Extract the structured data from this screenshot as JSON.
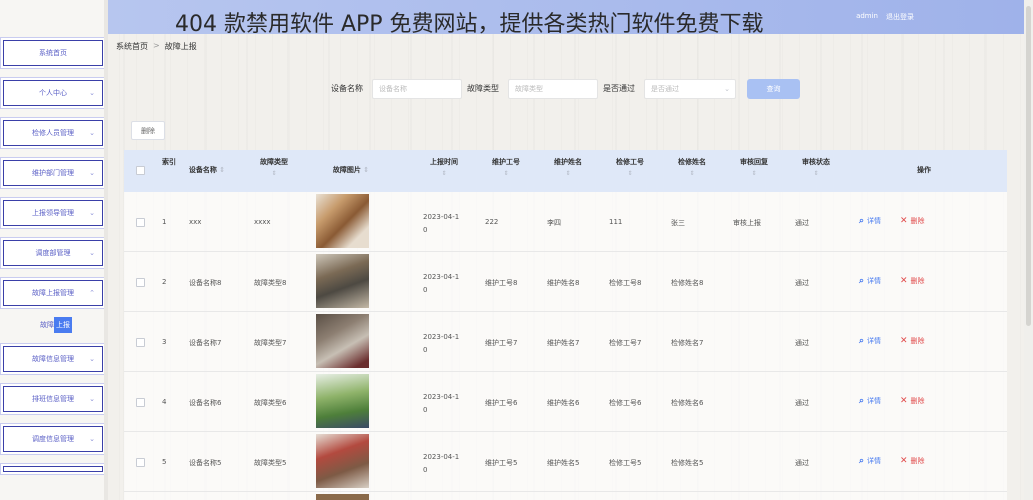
{
  "overlay_title": "404 款禁用软件 APP 免费网站，提供各类热门软件免费下载",
  "topbar": {
    "user": "admin",
    "logout": "退出登录"
  },
  "sidebar": {
    "items": [
      {
        "label": "系统首页",
        "chevron": ""
      },
      {
        "label": "个人中心",
        "chevron": "⌄"
      },
      {
        "label": "检修人员管理",
        "chevron": "⌄"
      },
      {
        "label": "维护部门管理",
        "chevron": "⌄"
      },
      {
        "label": "上报领导管理",
        "chevron": "⌄"
      },
      {
        "label": "调度部管理",
        "chevron": "⌄"
      },
      {
        "label": "故障上报管理",
        "chevron": "⌃"
      },
      {
        "label": "故障信息管理",
        "chevron": "⌄"
      },
      {
        "label": "排班信息管理",
        "chevron": "⌄"
      },
      {
        "label": "调度信息管理",
        "chevron": "⌄"
      }
    ],
    "submenu": {
      "prefix": "故障",
      "highlight": "上报"
    }
  },
  "breadcrumb": {
    "home": "系统首页",
    "sep": ">",
    "current": "故障上报"
  },
  "search": {
    "device_label": "设备名称",
    "device_placeholder": "设备名称",
    "fault_label": "故障类型",
    "fault_placeholder": "故障类型",
    "pass_label": "是否通过",
    "pass_placeholder": "是否通过",
    "query": "查询"
  },
  "toolbar": {
    "delete": "删除"
  },
  "table": {
    "headers": {
      "index": "索引",
      "device": "设备名称",
      "fault_type": "故障类型",
      "fault_image": "故障图片",
      "report_time": "上报时间",
      "maint_no": "维护工号",
      "maint_name": "维护姓名",
      "repair_no": "检修工号",
      "repair_name": "检修姓名",
      "review_reply": "审核回复",
      "review_status": "审核状态",
      "actions": "操作"
    },
    "sort_glyph": "⇕",
    "view_label": "详情",
    "delete_label": "删除",
    "rows": [
      {
        "index": "1",
        "device": "xxx",
        "fault_type": "xxxx",
        "time_a": "2023-04-1",
        "time_b": "0",
        "maint_no": "222",
        "maint_name": "李四",
        "repair_no": "111",
        "repair_name": "张三",
        "review_reply": "审核上报",
        "review_status": "通过"
      },
      {
        "index": "2",
        "device": "设备名称8",
        "fault_type": "故障类型8",
        "time_a": "2023-04-1",
        "time_b": "0",
        "maint_no": "维护工号8",
        "maint_name": "维护姓名8",
        "repair_no": "检修工号8",
        "repair_name": "检修姓名8",
        "review_reply": "",
        "review_status": "通过"
      },
      {
        "index": "3",
        "device": "设备名称7",
        "fault_type": "故障类型7",
        "time_a": "2023-04-1",
        "time_b": "0",
        "maint_no": "维护工号7",
        "maint_name": "维护姓名7",
        "repair_no": "检修工号7",
        "repair_name": "检修姓名7",
        "review_reply": "",
        "review_status": "通过"
      },
      {
        "index": "4",
        "device": "设备名称6",
        "fault_type": "故障类型6",
        "time_a": "2023-04-1",
        "time_b": "0",
        "maint_no": "维护工号6",
        "maint_name": "维护姓名6",
        "repair_no": "检修工号6",
        "repair_name": "检修姓名6",
        "review_reply": "",
        "review_status": "通过"
      },
      {
        "index": "5",
        "device": "设备名称5",
        "fault_type": "故障类型5",
        "time_a": "2023-04-1",
        "time_b": "0",
        "maint_no": "维护工号5",
        "maint_name": "维护姓名5",
        "repair_no": "检修工号5",
        "repair_name": "检修姓名5",
        "review_reply": "",
        "review_status": "通过"
      }
    ]
  },
  "colors": {
    "accent": "#4a7cf0",
    "danger": "#e14b4b",
    "header_bg": "#dfe8f8",
    "topbar": "#a9bbee"
  },
  "icons": {
    "view": "search-icon",
    "delete": "close-icon"
  }
}
